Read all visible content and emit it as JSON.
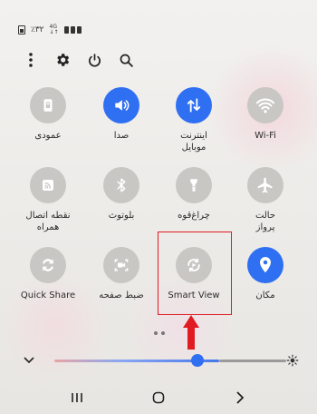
{
  "status_bar": {
    "signal_text": "٪٣٢",
    "net_top": "4G",
    "net_bottom": "↓↑"
  },
  "tiles": [
    {
      "label": "عمودی",
      "icon": "rotation-lock-icon",
      "active": false
    },
    {
      "label": "صدا",
      "icon": "sound-icon",
      "active": true
    },
    {
      "label": "اینترنت\nموبایل",
      "icon": "mobile-data-icon",
      "active": true
    },
    {
      "label": "Wi-Fi",
      "icon": "wifi-icon",
      "active": false
    },
    {
      "label": "نقطه اتصال\nهمراه",
      "icon": "hotspot-icon",
      "active": false
    },
    {
      "label": "بلوتوث",
      "icon": "bluetooth-icon",
      "active": false
    },
    {
      "label": "چراغ‌قوه",
      "icon": "flashlight-icon",
      "active": false
    },
    {
      "label": "حالت\nپرواز",
      "icon": "airplane-icon",
      "active": false
    },
    {
      "label": "Quick Share",
      "icon": "quick-share-icon",
      "active": false
    },
    {
      "label": "ضبط صفحه",
      "icon": "screen-record-icon",
      "active": false
    },
    {
      "label": "Smart View",
      "icon": "smart-view-icon",
      "active": false
    },
    {
      "label": "مکان",
      "icon": "location-icon",
      "active": true
    }
  ],
  "colors": {
    "accent": "#2f6ff2",
    "highlight": "#e01b22",
    "inactive_tile": "#c9c7c4"
  },
  "brightness": {
    "level": 0.62
  }
}
